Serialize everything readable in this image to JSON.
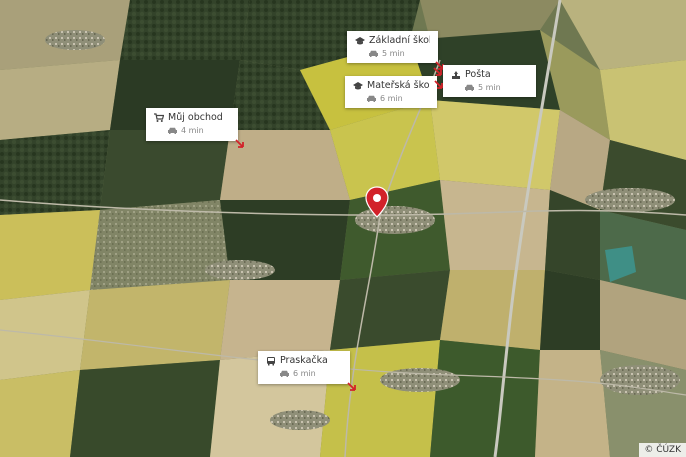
{
  "map": {
    "type": "satellite-aerial",
    "attribution": "© ČÚZK",
    "pin_icon": "location-pin-icon",
    "accent_color": "#d2222a",
    "features": [
      "fields-yellow",
      "fields-dark-green",
      "fields-brown",
      "forest",
      "villages",
      "roads",
      "pond"
    ]
  },
  "pois": [
    {
      "name": "Základní škola St...",
      "icon": "school-icon",
      "travel_icon": "car-icon",
      "time": "5 min"
    },
    {
      "name": "Pošta",
      "icon": "post-office-icon",
      "travel_icon": "car-icon",
      "time": "5 min"
    },
    {
      "name": "Mateřská škola, S...",
      "icon": "school-icon",
      "travel_icon": "car-icon",
      "time": "6 min"
    },
    {
      "name": "Můj obchod",
      "icon": "shop-cart-icon",
      "travel_icon": "car-icon",
      "time": "4 min"
    },
    {
      "name": "Praskačka",
      "icon": "bus-icon",
      "travel_icon": "car-icon",
      "time": "6 min"
    }
  ]
}
